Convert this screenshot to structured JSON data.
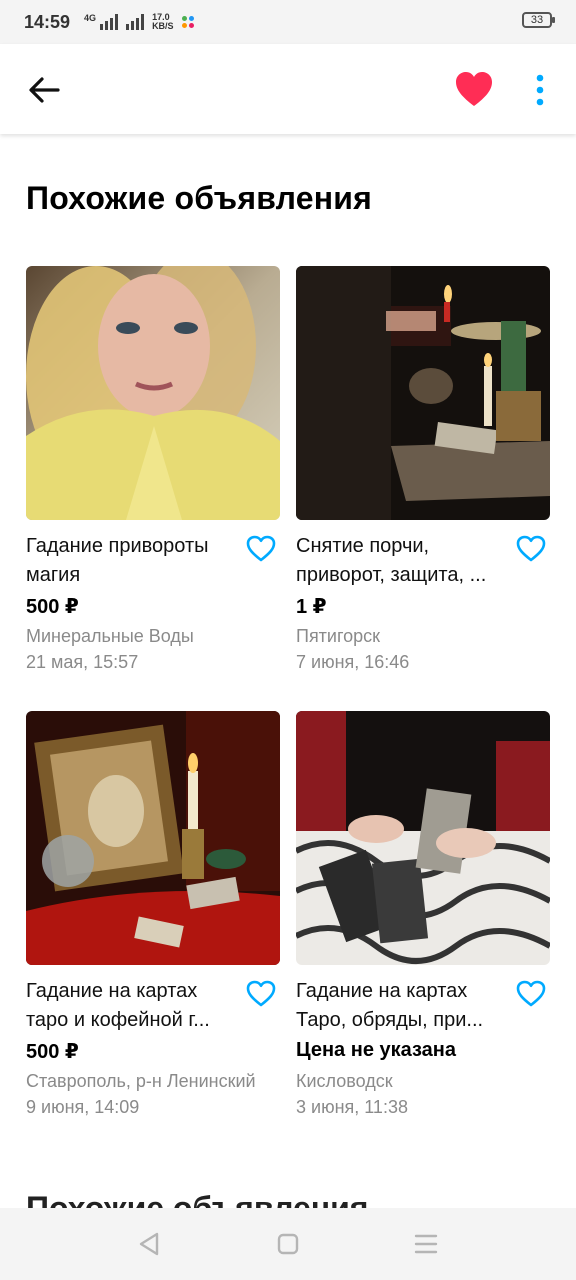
{
  "status_bar": {
    "time": "14:59",
    "network": "4G",
    "speed_value": "17.0",
    "speed_unit": "KB/S",
    "battery": "33"
  },
  "app_bar": {
    "back_icon": "arrow-left-icon",
    "favorite_icon": "heart-filled-icon",
    "favorite_color": "#ff2d55",
    "more_icon": "more-vertical-icon",
    "accent_color": "#00aaff"
  },
  "section_title": "Похожие объявления",
  "listings": [
    {
      "title": "Гадание привороты магия",
      "price": "500 ₽",
      "location": "Минеральные Воды",
      "date": "21 мая, 15:57"
    },
    {
      "title": "Снятие порчи, приворот, защита, ...",
      "price": "1 ₽",
      "location": "Пятигорск",
      "date": "7 июня, 16:46"
    },
    {
      "title": "Гадание на картах таро и кофейной г...",
      "price": "500 ₽",
      "location": "Ставрополь, р-н Ленинский",
      "date": "9 июня, 14:09"
    },
    {
      "title": "Гадание на картах Таро, обряды, при...",
      "price": "Цена не указана",
      "location": "Кисловодск",
      "date": "3 июня, 11:38"
    }
  ],
  "next_section_title": "Похожие объявления",
  "nav_bar": {
    "back_icon": "triangle-back-icon",
    "home_icon": "square-home-icon",
    "recents_icon": "menu-lines-icon"
  }
}
